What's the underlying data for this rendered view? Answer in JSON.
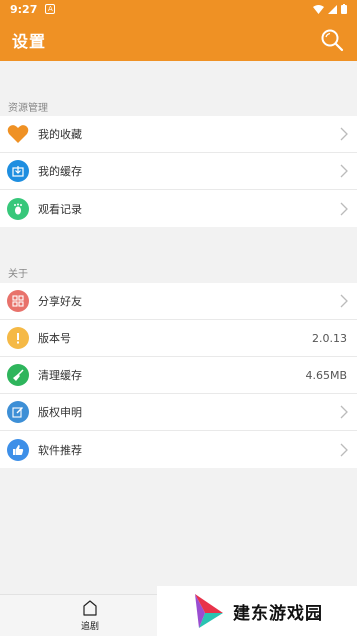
{
  "status_bar": {
    "time": "9:27",
    "notification_glyph": "A"
  },
  "app_bar": {
    "title": "设置"
  },
  "sections": [
    {
      "label": "资源管理",
      "items": [
        {
          "label": "我的收藏",
          "icon": "heart-icon",
          "color": "#ef9124",
          "chevron": true
        },
        {
          "label": "我的缓存",
          "icon": "download-icon",
          "color": "#1e8ee0",
          "chevron": true
        },
        {
          "label": "观看记录",
          "icon": "footprint-icon",
          "color": "#37c77a",
          "chevron": true
        }
      ]
    },
    {
      "label": "关于",
      "items": [
        {
          "label": "分享好友",
          "icon": "share-grid-icon",
          "color": "#e8726b",
          "chevron": true
        },
        {
          "label": "版本号",
          "icon": "info-icon",
          "color": "#f5b946",
          "value": "2.0.13"
        },
        {
          "label": "清理缓存",
          "icon": "broom-icon",
          "color": "#2eb55c",
          "value": "4.65MB"
        },
        {
          "label": "版权申明",
          "icon": "edit-icon",
          "color": "#3d8fd6",
          "chevron": true
        },
        {
          "label": "软件推荐",
          "icon": "thumbs-up-icon",
          "color": "#3d8fe8",
          "chevron": true
        }
      ]
    }
  ],
  "bottom_nav": {
    "items": [
      {
        "label": "追剧",
        "icon": "home-icon"
      }
    ]
  },
  "watermark": {
    "text": "建东游戏园",
    "colors": [
      "#e8334a",
      "#29c4b2",
      "#9a4dd1"
    ]
  },
  "colors": {
    "brand": "#ef9124"
  }
}
